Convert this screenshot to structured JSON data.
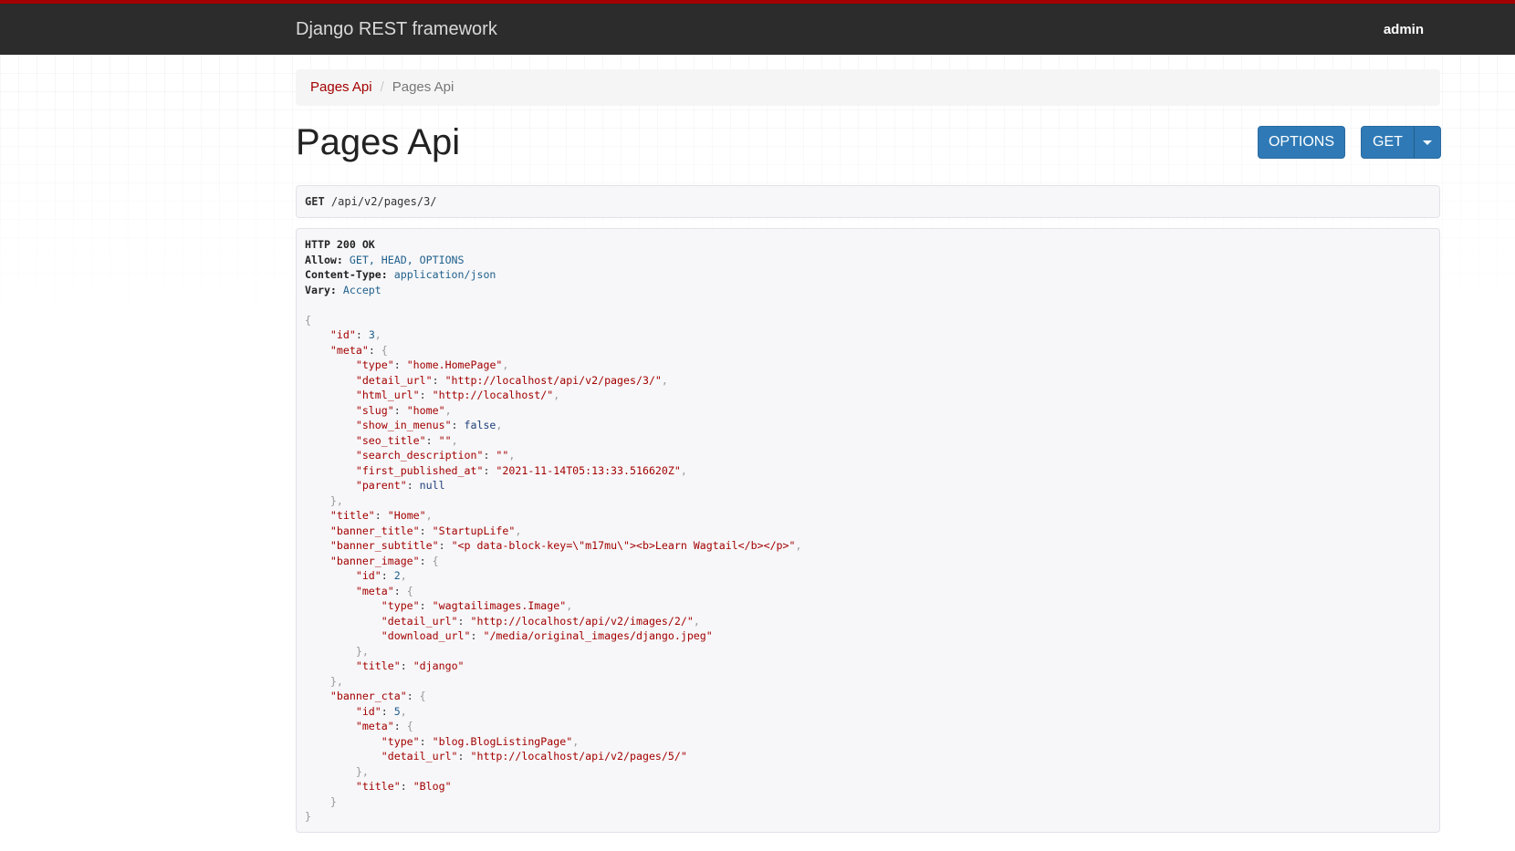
{
  "navbar": {
    "brand": "Django REST framework",
    "user": "admin"
  },
  "breadcrumb": {
    "link": "Pages Api",
    "separator": "/",
    "active": "Pages Api"
  },
  "page": {
    "title": "Pages Api"
  },
  "buttons": {
    "options_label": "OPTIONS",
    "get_label": "GET",
    "get_caret_icon": "caret-down-icon"
  },
  "request": {
    "method": "GET",
    "path": "/api/v2/pages/3/"
  },
  "response": {
    "status": "HTTP 200 OK",
    "headers": {
      "allow_key": "Allow:",
      "allow_val": "GET, HEAD, OPTIONS",
      "content_type_key": "Content-Type:",
      "content_type_val": "application/json",
      "vary_key": "Vary:",
      "vary_val": "Accept"
    },
    "json": {
      "id": "3",
      "meta_type": "\"home.HomePage\"",
      "meta_detail_url": "\"http://localhost/api/v2/pages/3/\"",
      "meta_html_url": "\"http://localhost/\"",
      "meta_slug": "\"home\"",
      "meta_show_in_menus": "false",
      "meta_seo_title": "\"\"",
      "meta_search_description": "\"\"",
      "meta_first_published_at": "\"2021-11-14T05:13:33.516620Z\"",
      "meta_parent": "null",
      "title": "\"Home\"",
      "banner_title": "\"StartupLife\"",
      "banner_subtitle": "\"<p data-block-key=\\\"m17mu\\\"><b>Learn Wagtail</b></p>\"",
      "banner_image_id": "2",
      "banner_image_meta_type": "\"wagtailimages.Image\"",
      "banner_image_meta_detail_url": "\"http://localhost/api/v2/images/2/\"",
      "banner_image_meta_download_url": "\"/media/original_images/django.jpeg\"",
      "banner_image_title": "\"django\"",
      "banner_cta_id": "5",
      "banner_cta_meta_type": "\"blog.BlogListingPage\"",
      "banner_cta_meta_detail_url": "\"http://localhost/api/v2/pages/5/\"",
      "banner_cta_title": "\"Blog\""
    }
  }
}
